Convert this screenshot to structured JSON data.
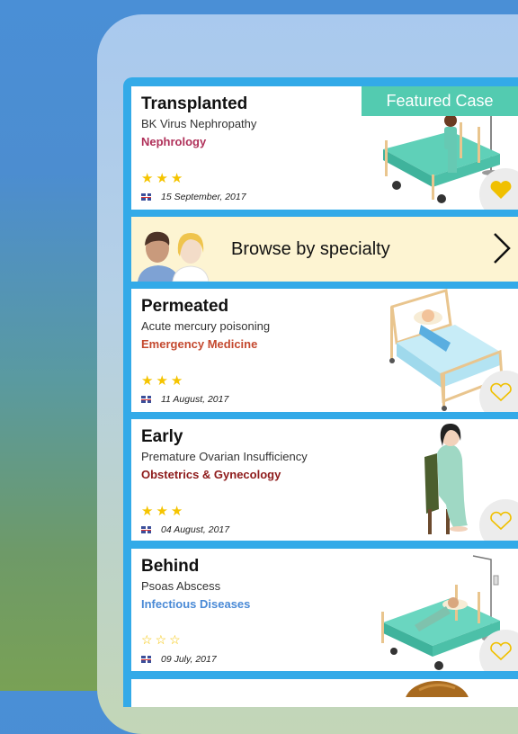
{
  "featured_label": "Featured Case",
  "browse": {
    "label": "Browse by specialty"
  },
  "cases": [
    {
      "title": "Transplanted",
      "subtitle": "BK Virus Nephropathy",
      "specialty": "Nephrology",
      "specialty_color": "#b0315a",
      "rating": 3,
      "rating_max": 3,
      "language_flag": "uk-flag",
      "date": "15 September, 2017",
      "favorited": true,
      "featured": true
    },
    {
      "title": "Permeated",
      "subtitle": "Acute mercury poisoning",
      "specialty": "Emergency Medicine",
      "specialty_color": "#c4492f",
      "rating": 3,
      "rating_max": 3,
      "language_flag": "uk-flag",
      "date": "11 August, 2017",
      "favorited": false,
      "featured": false
    },
    {
      "title": "Early",
      "subtitle": "Premature Ovarian Insufficiency",
      "specialty": "Obstetrics & Gynecology",
      "specialty_color": "#8e1b1b",
      "rating": 3,
      "rating_max": 3,
      "language_flag": "uk-flag",
      "date": "04 August, 2017",
      "favorited": false,
      "featured": false
    },
    {
      "title": "Behind",
      "subtitle": "Psoas Abscess",
      "specialty": "Infectious Diseases",
      "specialty_color": "#4a8ad6",
      "rating": 0,
      "rating_max": 3,
      "language_flag": "uk-flag",
      "date": "09 July, 2017",
      "favorited": false,
      "featured": false
    }
  ],
  "colors": {
    "list_background": "#33aae8",
    "star": "#f5c400",
    "heart": "#f0c000",
    "featured_badge": "#53cbb0",
    "browse_background": "#fdf4d2"
  }
}
